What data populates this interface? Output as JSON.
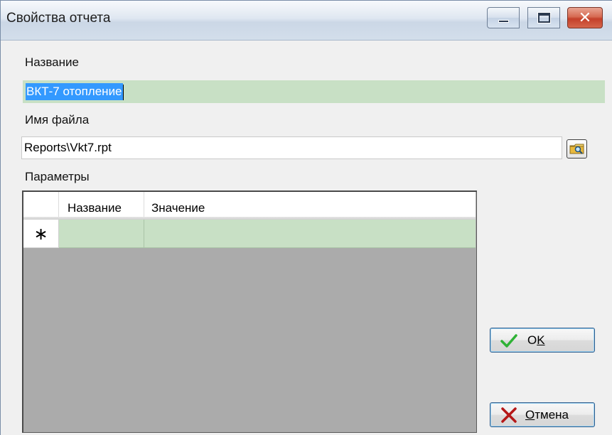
{
  "window": {
    "title": "Свойства отчета",
    "close_glyph": "✕"
  },
  "fields": {
    "name_label": "Название",
    "name_value": "ВКТ-7 отопление",
    "file_label": "Имя файла",
    "file_value": "Reports\\Vkt7.rpt",
    "params_label": "Параметры"
  },
  "grid": {
    "columns": [
      "Название",
      "Значение"
    ],
    "new_row_marker": "∗"
  },
  "buttons": {
    "ok_label_pre": "O",
    "ok_label_accel": "K",
    "ok_label_post": "",
    "cancel_label_pre": "",
    "cancel_label_accel": "О",
    "cancel_label_post": "тмена"
  },
  "icons": {
    "browse": "folder-search-icon",
    "ok": "checkmark-icon",
    "cancel": "red-x-icon"
  },
  "colors": {
    "selected_row": "#c8e0c5",
    "grid_background": "#ababab",
    "text_selection": "#3399ff"
  }
}
